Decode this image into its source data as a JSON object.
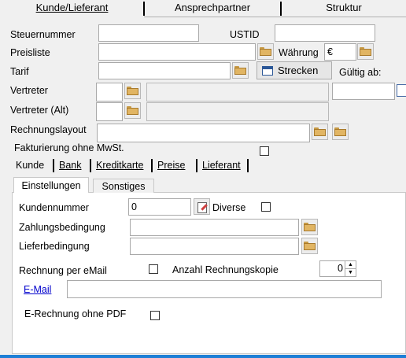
{
  "tabs": [
    "Kunde/Lieferant",
    "Ansprechpartner",
    "Struktur"
  ],
  "fields": {
    "steuernummer": "Steuernummer",
    "ustid": "USTID",
    "preisliste": "Preisliste",
    "waehrung": "Währung",
    "waehrung_value": "€",
    "tarif": "Tarif",
    "strecken_button": "Strecken",
    "gueltig_ab": "Gültig ab:",
    "vertreter": "Vertreter",
    "vertreter_alt": "Vertreter (Alt)",
    "rechnungslayout": "Rechnungslayout",
    "fakturierung": "Fakturierung ohne MwSt."
  },
  "sub_tabs": [
    "Kunde",
    "Bank",
    "Kreditkarte",
    "Preise",
    "Lieferant"
  ],
  "inner_tabs": [
    "Einstellungen",
    "Sonstiges"
  ],
  "einstellungen": {
    "kundennummer_label": "Kundennummer",
    "kundennummer_value": "0",
    "diverse": "Diverse",
    "zahlungsbedingung": "Zahlungsbedingung",
    "lieferbedingung": "Lieferbedingung",
    "rechnung_email": "Rechnung per eMail",
    "anzahl_kopie": "Anzahl Rechnungskopie",
    "anzahl_kopie_value": "0",
    "email_link": "E-Mail",
    "e_rechnung": "E-Rechnung ohne PDF"
  },
  "colors": {
    "accent_bar": "#1e7fd6",
    "link": "#0000cc"
  }
}
